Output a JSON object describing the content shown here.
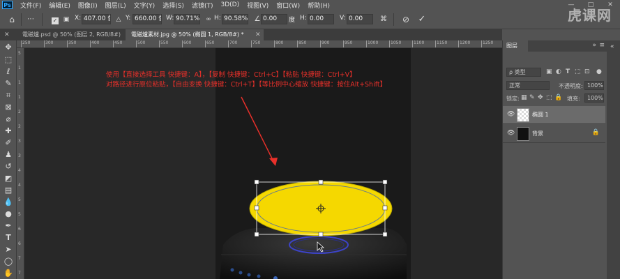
{
  "app": {
    "logo": "Ps"
  },
  "menu": [
    "文件(F)",
    "编辑(E)",
    "图像(I)",
    "图层(L)",
    "文字(Y)",
    "选择(S)",
    "滤镜(T)",
    "3D(D)",
    "视图(V)",
    "窗口(W)",
    "帮助(H)"
  ],
  "window_controls": [
    "—",
    "□",
    "✕"
  ],
  "watermark": "虎课网",
  "options": {
    "x_label": "X:",
    "x_value": "407.00 像",
    "y_label": "Y:",
    "y_value": "660.00 像",
    "w_label": "W:",
    "w_value": "90.71%",
    "h_label": "H:",
    "h_value": "90.58%",
    "angle_value": "0.00",
    "hskew_label": "H:",
    "hskew_value": "0.00",
    "vskew_label": "V:",
    "vskew_value": "0.00",
    "angle_unit": "度"
  },
  "tabs": [
    {
      "label": "電磁爐.psd @ 50% (图层 2, RGB/8#)",
      "active": false
    },
    {
      "label": "電磁爐素材.jpg @ 50% (椭圆 1, RGB/8#) *",
      "active": true
    }
  ],
  "ruler_top": [
    "250",
    "300",
    "350",
    "400",
    "450",
    "500",
    "550",
    "600",
    "650",
    "700",
    "750",
    "800",
    "850",
    "900",
    "950",
    "1000",
    "1050",
    "1100",
    "1150",
    "1200",
    "1250"
  ],
  "ruler_left": [
    "5",
    "1",
    "1",
    "1",
    "2",
    "2",
    "3",
    "3",
    "4",
    "4",
    "5",
    "5",
    "6",
    "6",
    "7",
    "7"
  ],
  "annotation": {
    "line1": "使用【直接选择工具 快捷键：A】，【复制 快捷键：Ctrl+C】【粘贴 快捷键：Ctrl+V】",
    "line2": "对路径进行原位粘贴，【自由变换 快捷键：Ctrl+T】【等比例中心缩放 快捷键：按住Alt+Shift】",
    "color": "#e8302a"
  },
  "shape": {
    "fill": "#f5d800"
  },
  "layers_panel": {
    "title": "图层",
    "filter_label": "ρ 类型",
    "blend_mode": "正常",
    "opacity_label": "不透明度:",
    "opacity_value": "100%",
    "lock_label": "锁定:",
    "fill_label": "填充:",
    "fill_value": "100%",
    "layers": [
      {
        "name": "椭圆 1",
        "selected": true
      },
      {
        "name": "背景",
        "selected": false
      }
    ]
  }
}
